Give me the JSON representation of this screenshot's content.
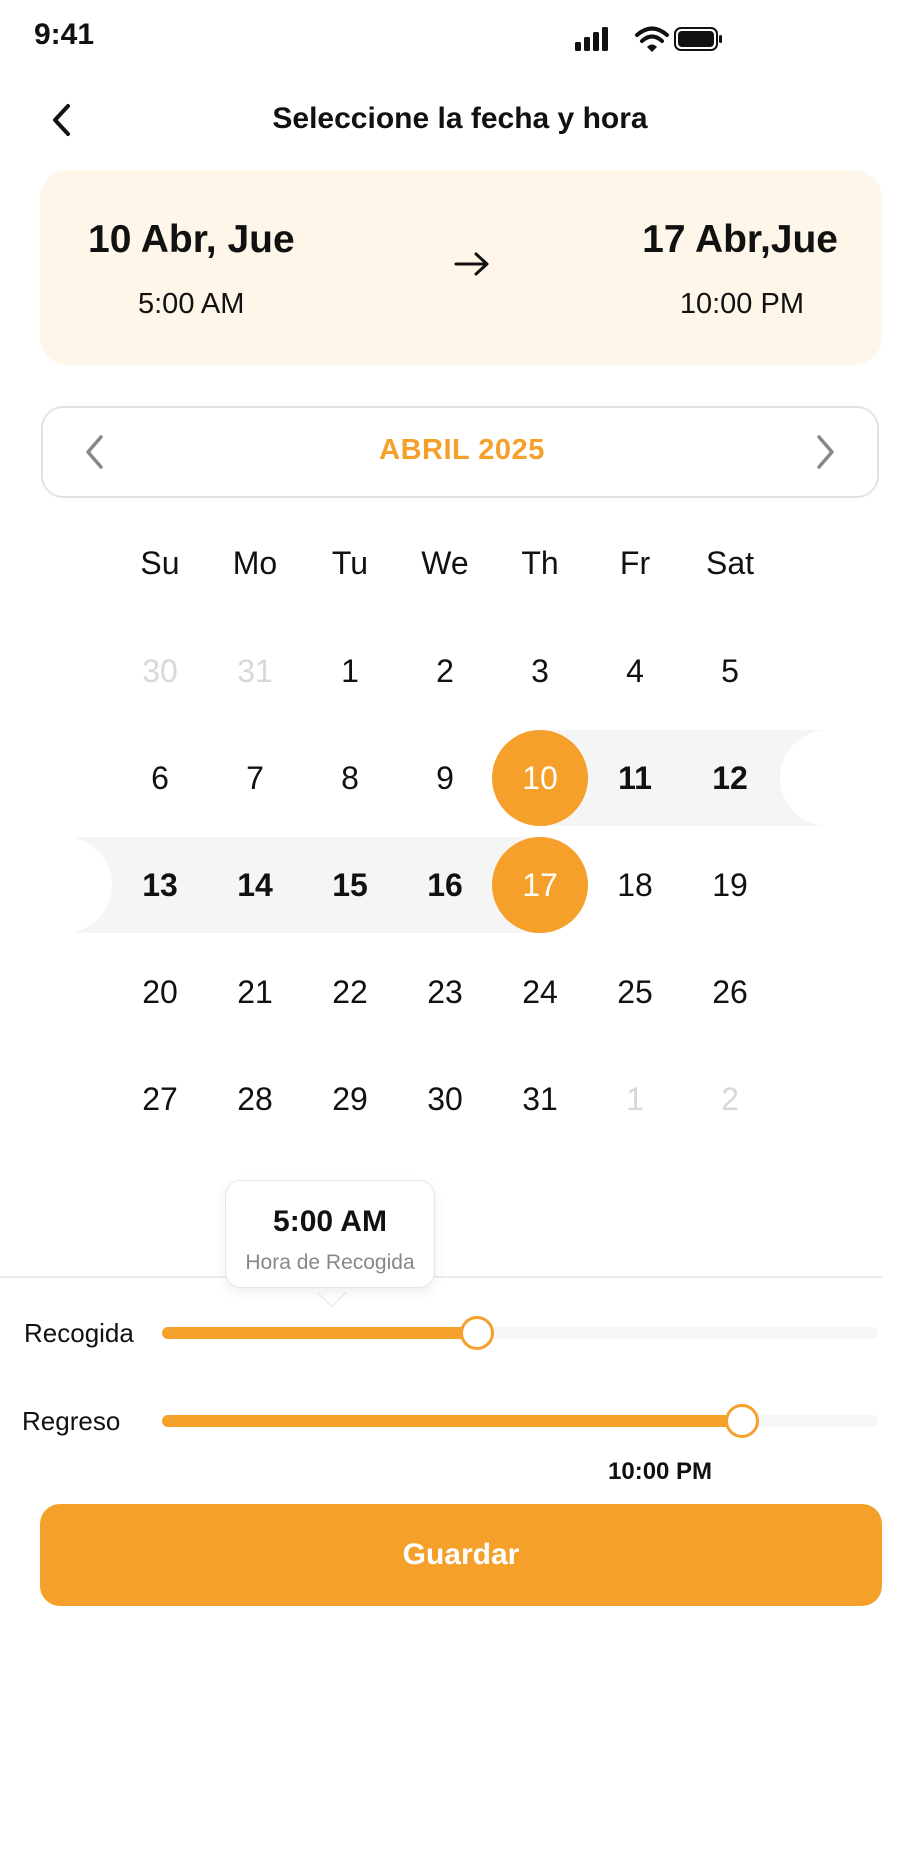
{
  "status": {
    "time": "9:41"
  },
  "header": {
    "title": "Seleccione la fecha y hora"
  },
  "summary": {
    "start_date": "10 Abr, Jue",
    "start_time": "5:00 AM",
    "end_date": "17 Abr,Jue",
    "end_time": "10:00 PM"
  },
  "calendar": {
    "month_label": "ABRIL 2025",
    "weekdays": [
      "Su",
      "Mo",
      "Tu",
      "We",
      "Th",
      "Fr",
      "Sat"
    ],
    "weeks": [
      [
        "30",
        "31",
        "1",
        "2",
        "3",
        "4",
        "5"
      ],
      [
        "6",
        "7",
        "8",
        "9",
        "10",
        "11",
        "12"
      ],
      [
        "13",
        "14",
        "15",
        "16",
        "17",
        "18",
        "19"
      ],
      [
        "20",
        "21",
        "22",
        "23",
        "24",
        "25",
        "26"
      ],
      [
        "27",
        "28",
        "29",
        "30",
        "31",
        "1",
        "2"
      ]
    ],
    "selected_start": "10",
    "selected_end": "17"
  },
  "tooltip": {
    "time": "5:00 AM",
    "label": "Hora de Recogida"
  },
  "sliders": {
    "pickup": {
      "label": "Recogida",
      "value_percent": 44
    },
    "return": {
      "label": "Regreso",
      "value_percent": 81,
      "value_text": "10:00 PM"
    }
  },
  "actions": {
    "save_label": "Guardar"
  },
  "colors": {
    "accent": "#f5a02a",
    "summary_bg": "#fff6ea",
    "range_bg": "#f5f5f5"
  }
}
